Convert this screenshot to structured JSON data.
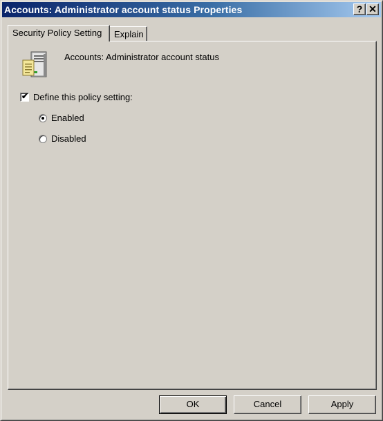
{
  "window": {
    "title": "Accounts: Administrator account status Properties"
  },
  "titlebar": {
    "help_glyph": "?",
    "close_glyph": "✕"
  },
  "tabs": [
    {
      "label": "Security Policy Setting",
      "active": true
    },
    {
      "label": "Explain",
      "active": false
    }
  ],
  "policy": {
    "name": "Accounts: Administrator account status",
    "icon": "server-policy-icon"
  },
  "define_setting": {
    "label": "Define this policy setting:",
    "checked": true
  },
  "options": [
    {
      "label": "Enabled",
      "selected": true
    },
    {
      "label": "Disabled",
      "selected": false
    }
  ],
  "buttons": {
    "ok": "OK",
    "cancel": "Cancel",
    "apply": "Apply"
  },
  "colors": {
    "titlebar_start": "#0a246a",
    "titlebar_end": "#a6caf0",
    "face": "#d4d0c8"
  }
}
